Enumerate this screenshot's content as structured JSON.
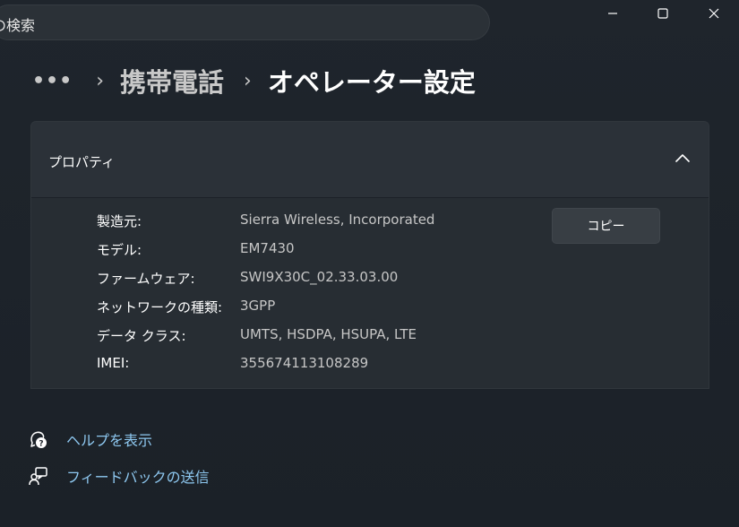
{
  "search": {
    "value": "の検索"
  },
  "window_controls": {
    "minimize_icon": "minimize-icon",
    "maximize_icon": "maximize-icon",
    "close_icon": "close-icon"
  },
  "breadcrumb": {
    "more": "•••",
    "separator": "›",
    "parent": "携帯電話",
    "current": "オペレーター設定"
  },
  "properties": {
    "title": "プロパティ",
    "copy_label": "コピー",
    "rows": [
      {
        "label": "製造元:",
        "value": "Sierra Wireless, Incorporated"
      },
      {
        "label": "モデル:",
        "value": "EM7430"
      },
      {
        "label": "ファームウェア:",
        "value": "SWI9X30C_02.33.03.00"
      },
      {
        "label": "ネットワークの種類:",
        "value": "3GPP"
      },
      {
        "label": "データ クラス:",
        "value": "UMTS, HSDPA, HSUPA, LTE"
      },
      {
        "label": "IMEI:",
        "value": "355674113108289"
      }
    ]
  },
  "links": {
    "help": "ヘルプを表示",
    "feedback": "フィードバックの送信"
  },
  "colors": {
    "background": "#1c2229",
    "card": "#2b3138",
    "link": "#8ec8f0"
  }
}
